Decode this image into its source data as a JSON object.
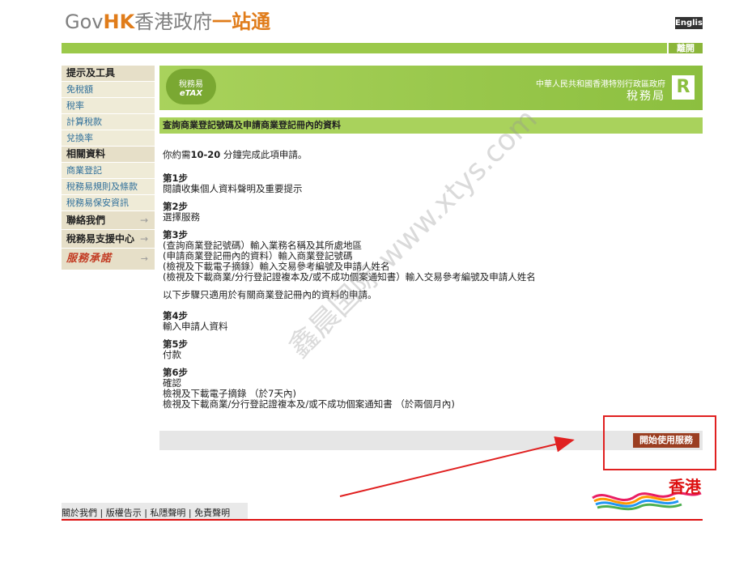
{
  "header": {
    "logo_gov": "Gov",
    "logo_hk": "HK",
    "logo_cn": "香港政府",
    "logo_stop": "一站通",
    "english_label": "English",
    "leave_label": "離開"
  },
  "sidebar": {
    "tools_heading": "提示及工具",
    "tools": [
      "免稅額",
      "稅率",
      "計算稅款",
      "兌換率"
    ],
    "related_heading": "相關資料",
    "related": [
      "商業登記",
      "稅務易規則及條款",
      "稅務易保安資訊"
    ],
    "contact_label": "聯絡我們",
    "support_label": "稅務易支援中心",
    "brand_label": "服務承諾",
    "arrow": "→"
  },
  "banner": {
    "etax_cn": "稅務易",
    "etax_en": "eTAX",
    "gov_name": "中華人民共和國香港特別行政區政府",
    "dept_name": "稅務局"
  },
  "page": {
    "title": "查詢商業登記號碼及申請商業登記冊內的資料",
    "intro_prefix": "你約需",
    "intro_time": "10-20",
    "intro_suffix": " 分鐘完成此項申請。",
    "steps": [
      {
        "label": "第1步",
        "lines": [
          "閱讀收集個人資料聲明及重要提示"
        ]
      },
      {
        "label": "第2步",
        "lines": [
          "選擇服務"
        ]
      },
      {
        "label": "第3步",
        "lines": [
          "(查詢商業登記號碼）輸入業務名稱及其所處地區",
          "(申請商業登記冊內的資料）輸入商業登記號碼",
          "(檢視及下載電子摘錄）輸入交易參考編號及申請人姓名",
          "(檢視及下載商業/分行登記證複本及/或不成功個案通知書）輸入交易參考編號及申請人姓名"
        ]
      }
    ],
    "note": "以下步驟只適用於有關商業登記冊內的資料的申請。",
    "steps2": [
      {
        "label": "第4步",
        "lines": [
          "輸入申請人資料"
        ]
      },
      {
        "label": "第5步",
        "lines": [
          "付款"
        ]
      },
      {
        "label": "第6步",
        "lines": [
          "確認",
          "檢視及下載電子摘錄 （於7天內)",
          "檢視及下載商業/分行登記證複本及/或不成功個案通知書 （於兩個月內)"
        ]
      }
    ],
    "start_button": "開始使用服務"
  },
  "brandhk": "香港",
  "footer": {
    "links": [
      "關於我們",
      "版權告示",
      "私隱聲明",
      "免責聲明"
    ],
    "separator": " | "
  },
  "watermark": "鑫晨国际 www.xtys.com",
  "colors": {
    "green": "#9bc94a",
    "brown_button": "#9b3e21",
    "red": "#d11111",
    "annotation_red": "#e02020"
  }
}
